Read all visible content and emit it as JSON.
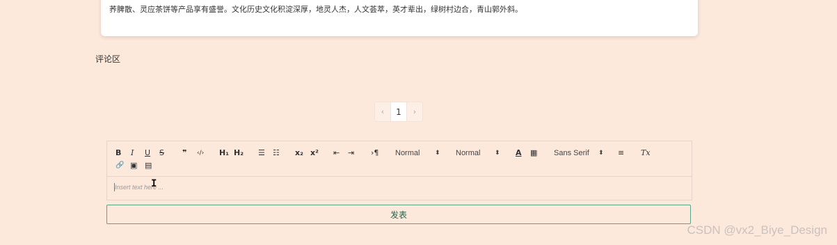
{
  "article": {
    "text": "荞脾散、灵应茶饼等产品享有盛誉。文化历史文化积淀深厚，地灵人杰，人文荟萃，英才辈出，绿树村边合，青山郭外斜。"
  },
  "comments": {
    "title": "评论区"
  },
  "pagination": {
    "prev": "‹",
    "current": "1",
    "next": "›"
  },
  "editor": {
    "toolbar": {
      "bold": "B",
      "italic": "I",
      "underline": "U",
      "strike": "S",
      "blockquote": "❞",
      "code": "‹/›",
      "h1": "H₁",
      "h2": "H₂",
      "ordered_list": "☰",
      "bullet_list": "☷",
      "subscript": "x₂",
      "superscript": "x²",
      "outdent": "⇤",
      "indent": "⇥",
      "direction": "›¶",
      "size_value": "Normal",
      "header_value": "Normal",
      "color": "A",
      "background": "▦",
      "font_value": "Sans Serif",
      "align": "≡",
      "clean": "Tx",
      "link": "🔗",
      "image": "▣",
      "video": "▤",
      "dropdown_arrow": "⬍"
    },
    "placeholder": "Insert text here ..."
  },
  "submit_label": "发表",
  "watermark": "CSDN @vx2_Biye_Design",
  "colors": {
    "background": "#fde8dc",
    "button_border": "#5aa388"
  }
}
